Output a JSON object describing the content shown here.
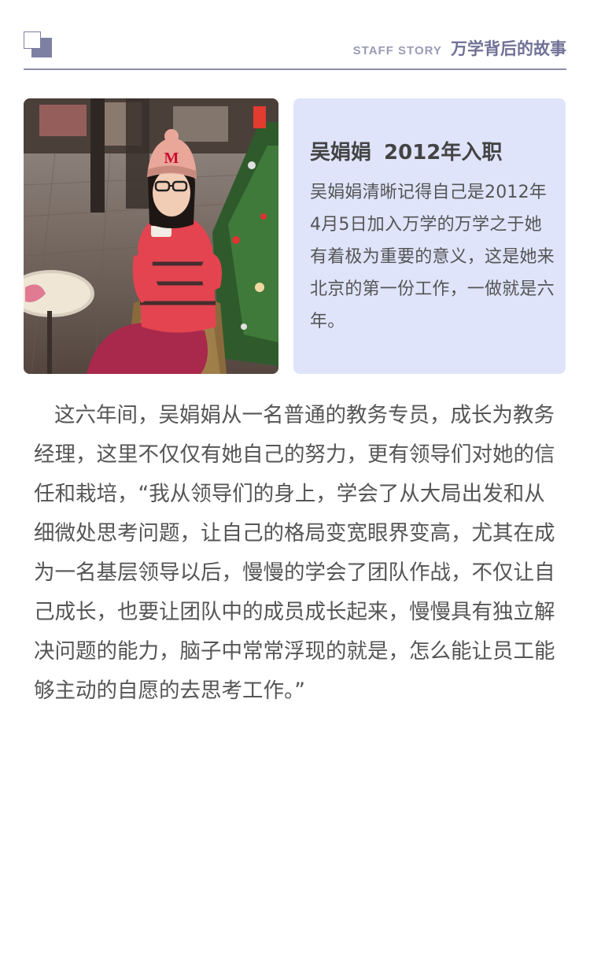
{
  "header": {
    "en_label": "STAFF STORY",
    "cn_title": "万学背后的故事"
  },
  "profile": {
    "name": "吴娟娟",
    "joined": "2012年入职",
    "intro": "吴娟娟清晰记得自己是2012年4月5日加入万学的万学之于她有着极为重要的意义，这是她来北京的第一份工作，一做就是六年。",
    "photo_sign_letter": "M"
  },
  "story": {
    "paragraph": "这六年间，吴娟娟从一名普通的教务专员，成长为教务经理，这里不仅仅有她自己的努力，更有领导们对她的信任和栽培，“我从领导们的身上，学会了从大局出发和从细微处思考问题，让自己的格局变宽眼界变高，尤其在成为一名基层领导以后，慢慢的学会了团队作战，不仅让自己成长，也要让团队中的成员成长起来，慢慢具有独立解决问题的能力，脑子中常常浮现的就是，怎么能让员工能够主动的自愿的去思考工作。”"
  },
  "colors": {
    "accent": "#7d7fa3",
    "card_bg": "#dfe4fa",
    "text": "#555555"
  }
}
